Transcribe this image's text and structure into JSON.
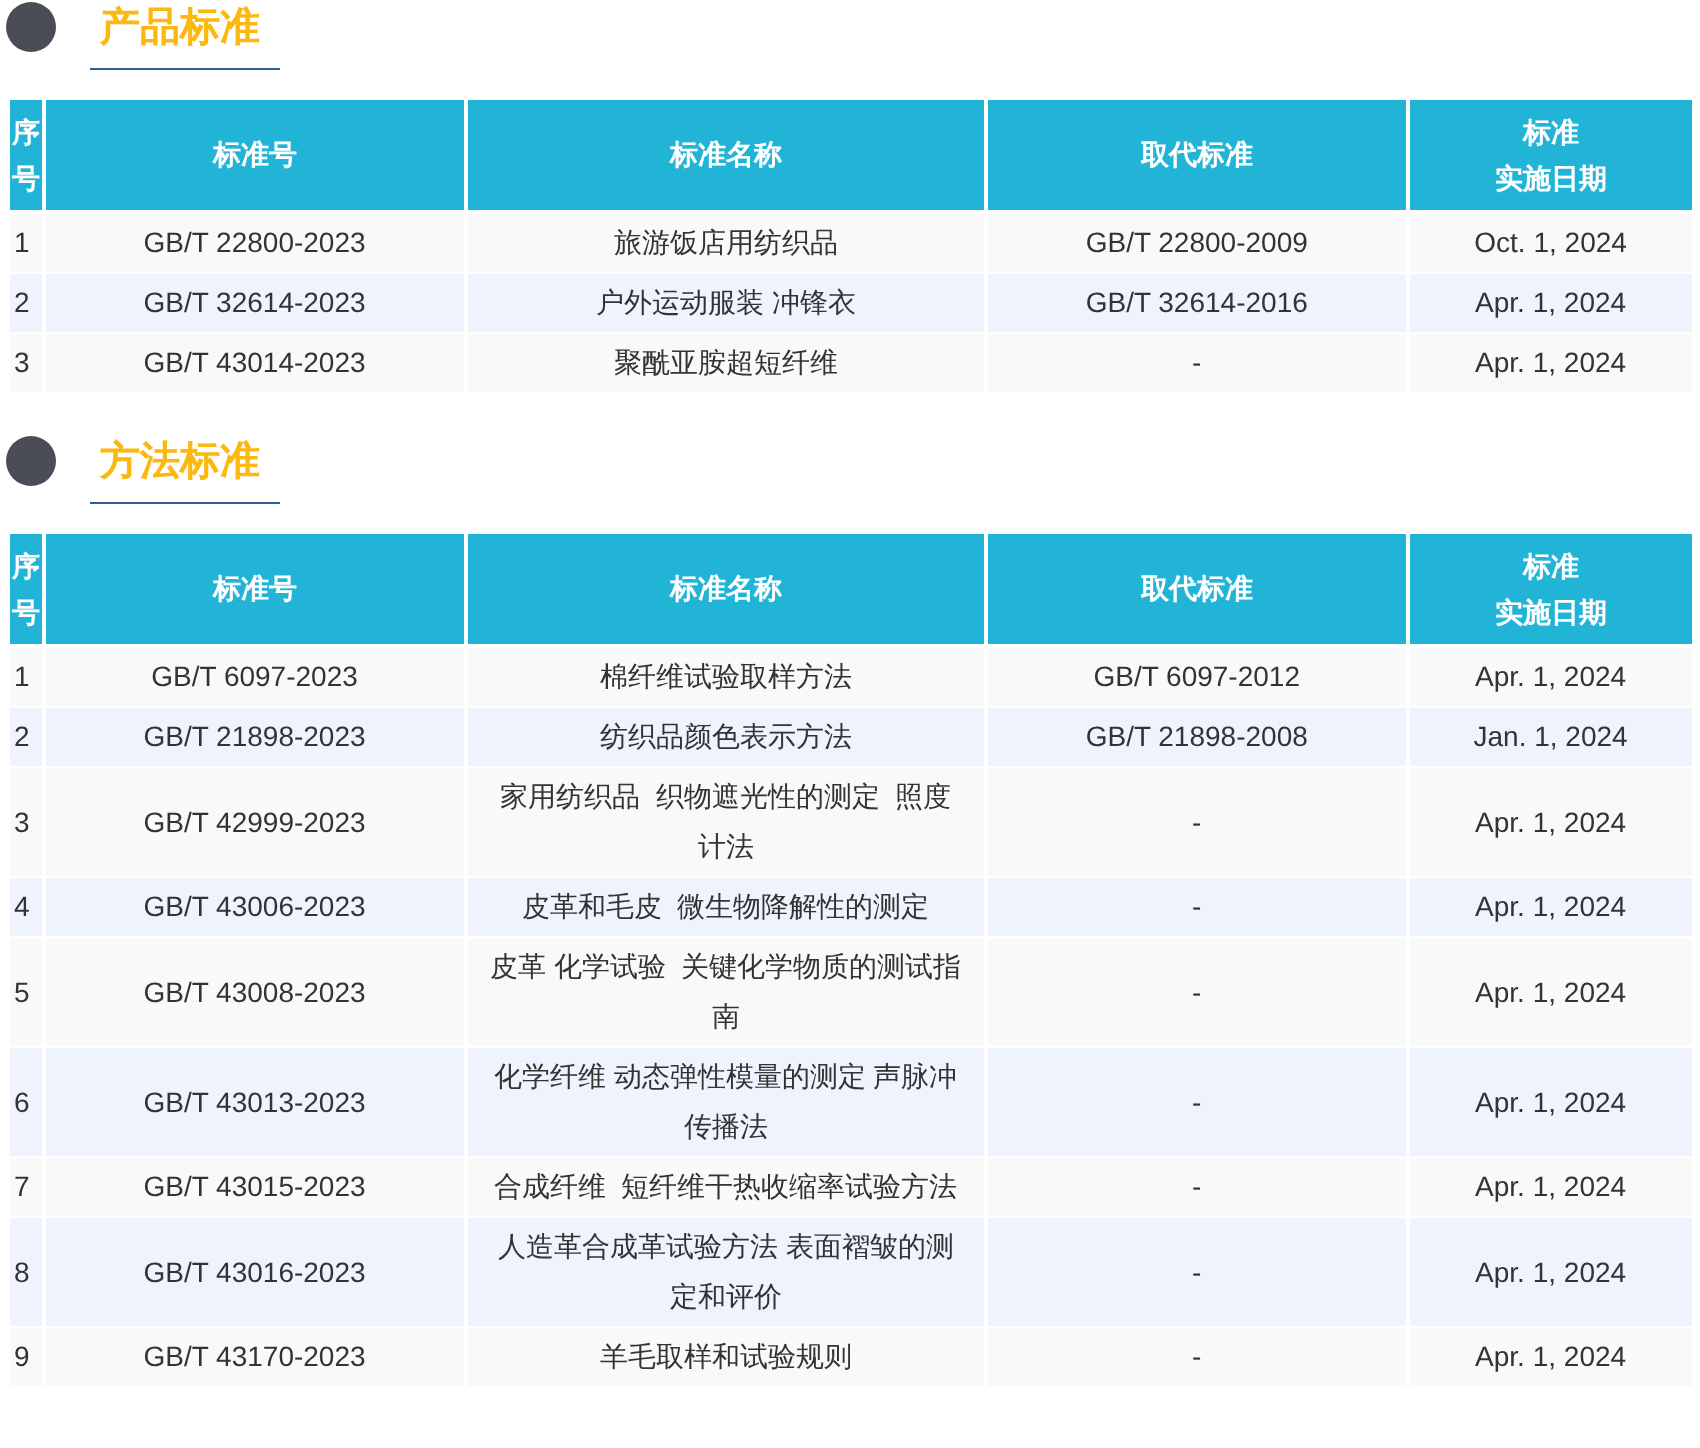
{
  "sections": [
    {
      "title": "产品标准",
      "columns": [
        "序号",
        "标准号",
        "标准名称",
        "取代标准",
        [
          "标准",
          "实施日期"
        ]
      ],
      "rows": [
        [
          "1",
          "GB/T 22800-2023",
          "旅游饭店用纺织品",
          "GB/T 22800-2009",
          "Oct. 1, 2024"
        ],
        [
          "2",
          "GB/T 32614-2023",
          "户外运动服装 冲锋衣",
          "GB/T 32614-2016",
          "Apr. 1, 2024"
        ],
        [
          "3",
          "GB/T 43014-2023",
          "聚酰亚胺超短纤维",
          "-",
          "Apr. 1, 2024"
        ]
      ]
    },
    {
      "title": "方法标准",
      "columns": [
        "序号",
        "标准号",
        "标准名称",
        "取代标准",
        [
          "标准",
          "实施日期"
        ]
      ],
      "rows": [
        [
          "1",
          "GB/T 6097-2023",
          "棉纤维试验取样方法",
          "GB/T 6097-2012",
          "Apr. 1, 2024"
        ],
        [
          "2",
          "GB/T 21898-2023",
          "纺织品颜色表示方法",
          "GB/T 21898-2008",
          "Jan. 1, 2024"
        ],
        [
          "3",
          "GB/T 42999-2023",
          "家用纺织品  织物遮光性的测定  照度计法",
          "-",
          "Apr. 1, 2024"
        ],
        [
          "4",
          "GB/T 43006-2023",
          "皮革和毛皮  微生物降解性的测定",
          "-",
          "Apr. 1, 2024"
        ],
        [
          "5",
          "GB/T 43008-2023",
          "皮革 化学试验  关键化学物质的测试指南",
          "-",
          "Apr. 1, 2024"
        ],
        [
          "6",
          "GB/T 43013-2023",
          "化学纤维 动态弹性模量的测定 声脉冲传播法",
          "-",
          "Apr. 1, 2024"
        ],
        [
          "7",
          "GB/T 43015-2023",
          "合成纤维  短纤维干热收缩率试验方法",
          "-",
          "Apr. 1, 2024"
        ],
        [
          "8",
          "GB/T 43016-2023",
          "人造革合成革试验方法 表面褶皱的测定和评价",
          "-",
          "Apr. 1, 2024"
        ],
        [
          "9",
          "GB/T 43170-2023",
          "羊毛取样和试验规则",
          "-",
          "Apr. 1, 2024"
        ]
      ]
    }
  ]
}
